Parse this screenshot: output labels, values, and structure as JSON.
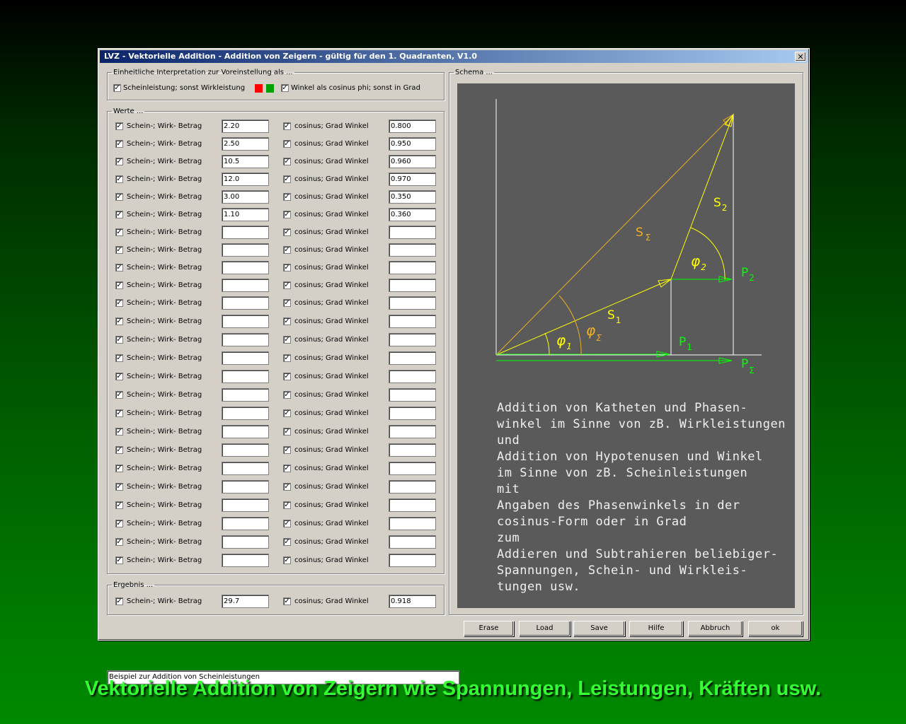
{
  "window": {
    "title": "LVZ - Vektorielle Addition - Addition von Zeigern - gültig für den 1. Quadranten, V1.0",
    "close_label": "✕"
  },
  "settings": {
    "legend": "Einheitliche Interpretation zur Voreinstellung als ...",
    "schein_label": "Scheinleistung; sonst Wirkleistung",
    "schein_checked": true,
    "winkel_label": "Winkel als cosinus phi; sonst in Grad",
    "winkel_checked": true,
    "indicator_colors": [
      "#ff0000",
      "#00a000"
    ]
  },
  "werte": {
    "legend": "Werte ...",
    "betrag_label": "Schein-; Wirk- Betrag",
    "winkel_label": "cosinus; Grad Winkel",
    "rows": [
      {
        "betrag": "2.20",
        "winkel": "0.800"
      },
      {
        "betrag": "2.50",
        "winkel": "0.950"
      },
      {
        "betrag": "10.5",
        "winkel": "0.960"
      },
      {
        "betrag": "12.0",
        "winkel": "0.970"
      },
      {
        "betrag": "3.00",
        "winkel": "0.350"
      },
      {
        "betrag": "1.10",
        "winkel": "0.360"
      },
      {
        "betrag": "",
        "winkel": ""
      },
      {
        "betrag": "",
        "winkel": ""
      },
      {
        "betrag": "",
        "winkel": ""
      },
      {
        "betrag": "",
        "winkel": ""
      },
      {
        "betrag": "",
        "winkel": ""
      },
      {
        "betrag": "",
        "winkel": ""
      },
      {
        "betrag": "",
        "winkel": ""
      },
      {
        "betrag": "",
        "winkel": ""
      },
      {
        "betrag": "",
        "winkel": ""
      },
      {
        "betrag": "",
        "winkel": ""
      },
      {
        "betrag": "",
        "winkel": ""
      },
      {
        "betrag": "",
        "winkel": ""
      },
      {
        "betrag": "",
        "winkel": ""
      },
      {
        "betrag": "",
        "winkel": ""
      },
      {
        "betrag": "",
        "winkel": ""
      },
      {
        "betrag": "",
        "winkel": ""
      },
      {
        "betrag": "",
        "winkel": ""
      },
      {
        "betrag": "",
        "winkel": ""
      },
      {
        "betrag": "",
        "winkel": ""
      }
    ]
  },
  "ergebnis": {
    "legend": "Ergebnis ...",
    "betrag_label": "Schein-; Wirk- Betrag",
    "betrag": "29.7",
    "winkel_label": "cosinus; Grad Winkel",
    "winkel": "0.918"
  },
  "schema": {
    "legend": "Schema ...",
    "labels": {
      "s_sigma": "S",
      "s_sigma_sub": "Σ",
      "s1": "S",
      "s1_sub": "1",
      "s2": "S",
      "s2_sub": "2",
      "phi1": "φ",
      "phi1_sub": "1",
      "phi2": "φ",
      "phi2_sub": "2",
      "phi_sigma": "φ",
      "phi_sigma_sub": "Σ",
      "p1": "P",
      "p1_sub": "1",
      "p2": "P",
      "p2_sub": "2",
      "p_sigma": "P",
      "p_sigma_sub": "Σ"
    },
    "colors": {
      "yellow": "#ffff00",
      "orange": "#f0b020",
      "green": "#00ff00",
      "white": "#ffffff",
      "panel": "#5a5a5a"
    },
    "description": [
      "Addition von Katheten und Phasen-",
      "winkel im Sinne von zB. Wirkleistungen",
      "und",
      "Addition von Hypotenusen und Winkel",
      "im Sinne von zB. Scheinleistungen",
      "mit",
      "Angaben des Phasenwinkels in der",
      "cosinus-Form oder in Grad",
      "zum",
      "Addieren und Subtrahieren beliebiger-",
      "Spannungen, Schein- und Wirkleis-",
      "tungen usw."
    ]
  },
  "footer": {
    "status_text": "Beispiel zur Addition von Scheinleistungen",
    "buttons": [
      "Erase",
      "Load",
      "Save",
      "Hilfe",
      "Abbruch",
      "ok"
    ]
  },
  "caption": "Vektorielle Addition von Zeigern wie Spannungen, Leistungen, Kräften usw."
}
